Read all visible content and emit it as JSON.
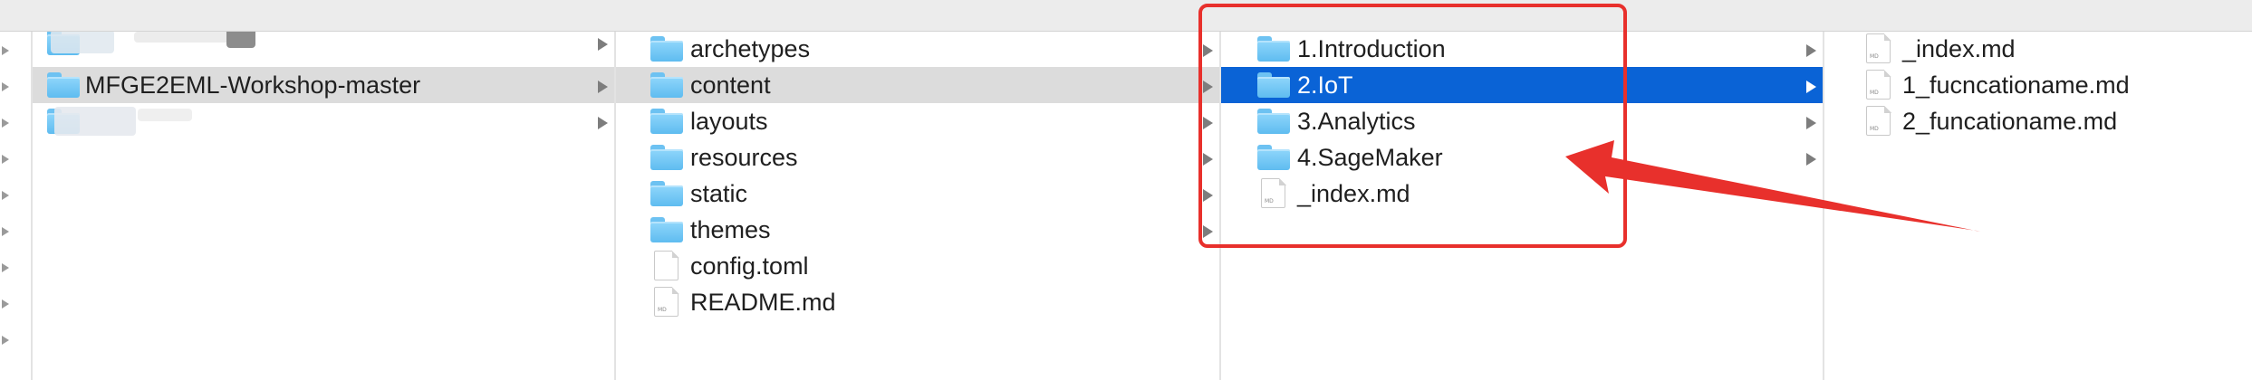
{
  "colors": {
    "selection": "#0a63d6",
    "highlight": "#dcdcdc",
    "folder": "#7cccf7",
    "annotation": "#e8302c"
  },
  "columns": [
    {
      "items": [
        {
          "label": "",
          "type": "folder",
          "obscured": true,
          "state": "normal",
          "chevron": true
        },
        {
          "label": "MFGE2EML-Workshop-master",
          "type": "folder",
          "state": "highlighted",
          "chevron": true
        },
        {
          "label": "",
          "type": "folder",
          "obscured": true,
          "state": "normal",
          "chevron": true
        }
      ]
    },
    {
      "items": [
        {
          "label": "archetypes",
          "type": "folder",
          "state": "normal",
          "chevron": true
        },
        {
          "label": "content",
          "type": "folder",
          "state": "highlighted",
          "chevron": true
        },
        {
          "label": "layouts",
          "type": "folder",
          "state": "normal",
          "chevron": true
        },
        {
          "label": "resources",
          "type": "folder",
          "state": "normal",
          "chevron": true
        },
        {
          "label": "static",
          "type": "folder",
          "state": "normal",
          "chevron": true
        },
        {
          "label": "themes",
          "type": "folder",
          "state": "normal",
          "chevron": true
        },
        {
          "label": "config.toml",
          "type": "file",
          "state": "normal",
          "chevron": false
        },
        {
          "label": "README.md",
          "type": "file",
          "state": "normal",
          "chevron": false
        }
      ]
    },
    {
      "items": [
        {
          "label": "1.Introduction",
          "type": "folder",
          "state": "normal",
          "chevron": true
        },
        {
          "label": "2.IoT",
          "type": "folder",
          "state": "selected",
          "chevron": true
        },
        {
          "label": "3.Analytics",
          "type": "folder",
          "state": "normal",
          "chevron": true
        },
        {
          "label": "4.SageMaker",
          "type": "folder",
          "state": "normal",
          "chevron": true
        },
        {
          "label": "_index.md",
          "type": "file",
          "state": "normal",
          "chevron": false
        }
      ]
    },
    {
      "items": [
        {
          "label": "_index.md",
          "type": "file",
          "state": "normal",
          "chevron": false
        },
        {
          "label": "1_fucncationame.md",
          "type": "file",
          "state": "normal",
          "chevron": false
        },
        {
          "label": "2_funcationame.md",
          "type": "file",
          "state": "normal",
          "chevron": false
        }
      ]
    }
  ],
  "file_tag": "MD",
  "icons": {
    "folder": "folder-icon",
    "file": "document-icon",
    "chevron": "chevron-right-icon"
  }
}
